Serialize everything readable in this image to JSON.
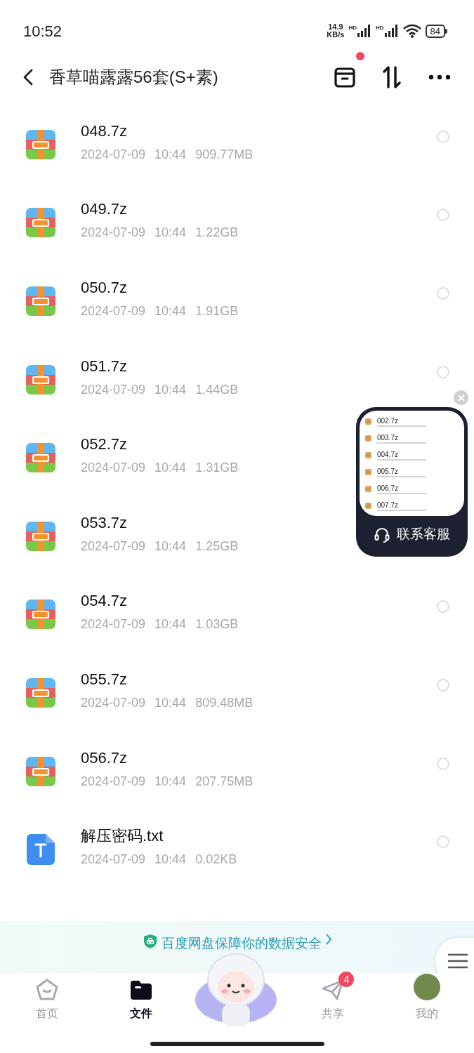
{
  "status_bar": {
    "time": "10:52",
    "net_speed": "14.9",
    "net_unit": "KB/s",
    "sim_labels": [
      "HD",
      "HD"
    ],
    "battery": "84"
  },
  "header": {
    "title": "香草喵露露56套(S+素)",
    "notification_dot": true
  },
  "files": [
    {
      "kind": "archive",
      "name": "048.7z",
      "date": "2024-07-09",
      "time": "10:44",
      "size": "909.77MB",
      "selected": false
    },
    {
      "kind": "archive",
      "name": "049.7z",
      "date": "2024-07-09",
      "time": "10:44",
      "size": "1.22GB",
      "selected": false
    },
    {
      "kind": "archive",
      "name": "050.7z",
      "date": "2024-07-09",
      "time": "10:44",
      "size": "1.91GB",
      "selected": false
    },
    {
      "kind": "archive",
      "name": "051.7z",
      "date": "2024-07-09",
      "time": "10:44",
      "size": "1.44GB",
      "selected": false
    },
    {
      "kind": "archive",
      "name": "052.7z",
      "date": "2024-07-09",
      "time": "10:44",
      "size": "1.31GB"
    },
    {
      "kind": "archive",
      "name": "053.7z",
      "date": "2024-07-09",
      "time": "10:44",
      "size": "1.25GB"
    },
    {
      "kind": "archive",
      "name": "054.7z",
      "date": "2024-07-09",
      "time": "10:44",
      "size": "1.03GB",
      "selected": false
    },
    {
      "kind": "archive",
      "name": "055.7z",
      "date": "2024-07-09",
      "time": "10:44",
      "size": "809.48MB",
      "selected": false
    },
    {
      "kind": "archive",
      "name": "056.7z",
      "date": "2024-07-09",
      "time": "10:44",
      "size": "207.75MB",
      "selected": false
    },
    {
      "kind": "text",
      "name": "解压密码.txt",
      "date": "2024-07-09",
      "time": "10:44",
      "size": "0.02KB",
      "selected": false
    }
  ],
  "floating_window": {
    "preview_files": [
      "002.7z",
      "003.7z",
      "004.7z",
      "005.7z",
      "006.7z",
      "007.7z"
    ],
    "label": "联系客服"
  },
  "banner": {
    "text": "百度网盘保障你的数据安全"
  },
  "tab_bar": [
    {
      "kind": "home",
      "label": "首页",
      "selected": false
    },
    {
      "kind": "files",
      "label": "文件",
      "selected": true
    },
    {
      "kind": "mascot"
    },
    {
      "kind": "share",
      "label": "共享",
      "badge": "4",
      "selected": false
    },
    {
      "kind": "profile",
      "label": "我的",
      "selected": false
    }
  ]
}
